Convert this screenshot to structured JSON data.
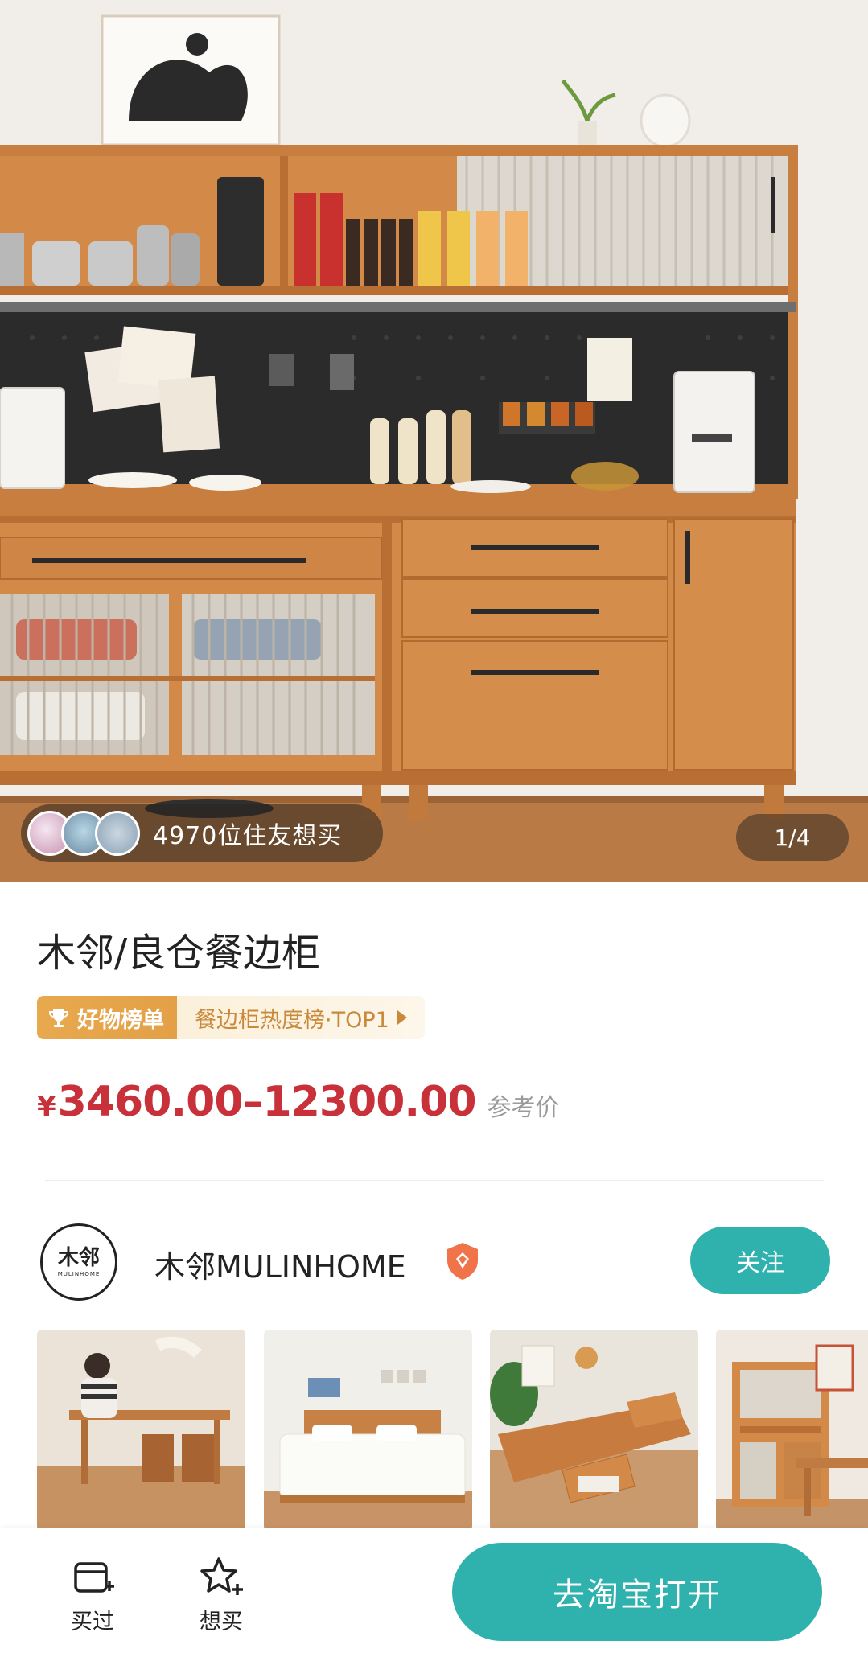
{
  "hero": {
    "want_count_text": "4970位住友想买",
    "page_indicator": "1/4"
  },
  "product": {
    "title": "木邻/良仓餐边柜",
    "rank_badge_label": "好物榜单",
    "rank_text": "餐边柜热度榜·TOP1",
    "currency": "¥",
    "price_range": "3460.00–12300.00",
    "price_note": "参考价"
  },
  "store": {
    "logo_text": "木邻",
    "logo_subtext": "MULINHOME",
    "name": "木邻MULINHOME",
    "follow_label": "关注"
  },
  "bottom_bar": {
    "bought_label": "买过",
    "want_label": "想买",
    "open_label": "去淘宝打开"
  },
  "colors": {
    "accent_teal": "#2fb2ad",
    "price_red": "#c8303a",
    "rank_gold": "#e3a047"
  }
}
